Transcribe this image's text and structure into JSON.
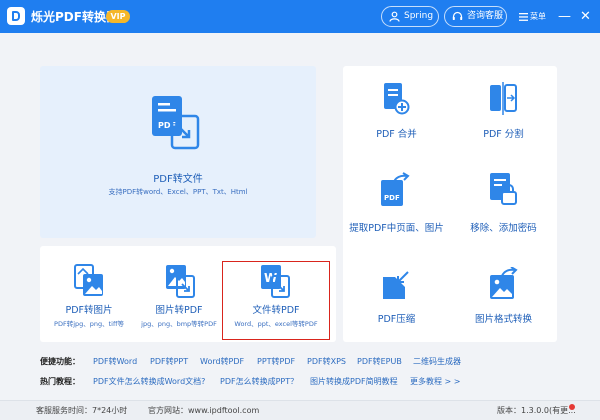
{
  "app": {
    "title": "烁光PDF转换器",
    "vip": "VIP"
  },
  "header": {
    "user": "Spring",
    "service": "咨询客服",
    "menu": "菜单",
    "minimize": "—",
    "close": "✕"
  },
  "big_card": {
    "title": "PDF转文件",
    "subtitle": "支持PDF转word、Excel、PPT、Txt、Html"
  },
  "small_cards": [
    {
      "title": "PDF转图片",
      "subtitle": "PDF转jpg、png、tiff等"
    },
    {
      "title": "图片转PDF",
      "subtitle": "jpg、png、bmp等转PDF"
    },
    {
      "title": "文件转PDF",
      "subtitle": "Word、ppt、excel等转PDF"
    }
  ],
  "tools": [
    {
      "title": "PDF 合并"
    },
    {
      "title": "PDF 分割"
    },
    {
      "title": "提取PDF中页面、图片"
    },
    {
      "title": "移除、添加密码"
    },
    {
      "title": "PDF压缩"
    },
    {
      "title": "图片格式转换"
    }
  ],
  "quick_links": {
    "label": "便捷功能：",
    "items": [
      "PDF转Word",
      "PDF转PPT",
      "Word转PDF",
      "PPT转PDF",
      "PDF转XPS",
      "PDF转EPUB",
      "二维码生成器"
    ]
  },
  "tutorials": {
    "label": "热门教程：",
    "items": [
      "PDF文件怎么转换成Word文档?",
      "PDF怎么转换成PPT？",
      "图片转换成PDF简明教程",
      "更多教程 > >"
    ]
  },
  "status": {
    "service_hours": "客服服务时间：7*24小时",
    "website": "官方网站：www.ipdftool.com",
    "version": "版本：1.3.0.0(有更..."
  },
  "colors": {
    "brand": "#1f7ef0",
    "vip": "#f5b72a",
    "highlight": "#d9251d"
  }
}
